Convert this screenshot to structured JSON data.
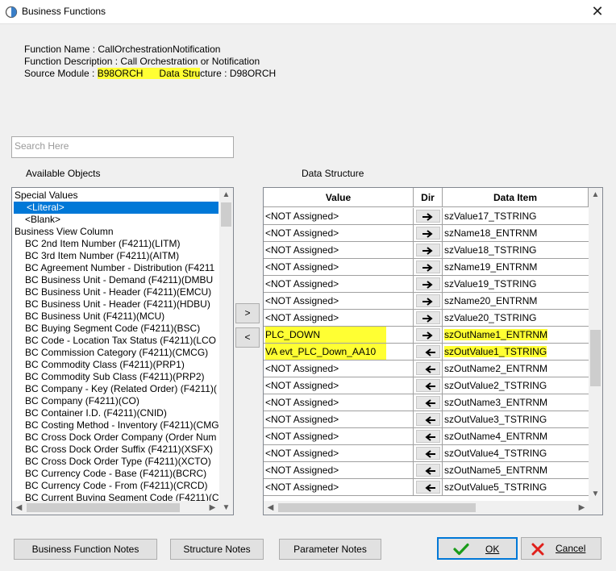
{
  "window": {
    "title": "Business Functions",
    "close_symbol": "✕"
  },
  "info": {
    "function_name_label": "Function Name : ",
    "function_name": "CallOrchestrationNotification",
    "function_description_label": "Function Description : ",
    "function_description": "Call Orchestration or Notification",
    "source_module_label": "Source Module : ",
    "source_module": "B98ORCH",
    "data_structure_label": "Data Structure : ",
    "data_structure": "D98ORCH",
    "data_structure_label_prefix": "Data Stru",
    "data_structure_label_suffix": "cture : "
  },
  "search": {
    "placeholder": "Search Here"
  },
  "available_objects": {
    "label": "Available Objects",
    "items": [
      "Special Values",
      "<Literal>",
      "<Blank>",
      "Business View Column",
      "BC 2nd Item Number (F4211)(LITM)",
      "BC 3rd Item Number (F4211)(AITM)",
      "BC Agreement Number - Distribution (F4211",
      "BC Business Unit - Demand (F4211)(DMBU",
      "BC Business Unit - Header (F4211)(EMCU)",
      "BC Business Unit - Header (F4211)(HDBU)",
      "BC Business Unit (F4211)(MCU)",
      "BC Buying Segment Code (F4211)(BSC)",
      "BC Code - Location Tax Status (F4211)(LCO",
      "BC Commission Category (F4211)(CMCG)",
      "BC Commodity Class (F4211)(PRP1)",
      "BC Commodity Sub Class (F4211)(PRP2)",
      "BC Company - Key (Related Order) (F4211)(",
      "BC Company (F4211)(CO)",
      "BC Container I.D. (F4211)(CNID)",
      "BC Costing Method - Inventory (F4211)(CMG",
      "BC Cross Dock Order Company (Order Num",
      "BC Cross Dock Order Suffix (F4211)(XSFX)",
      "BC Cross Dock Order Type (F4211)(XCTO)",
      "BC Currency Code - Base (F4211)(BCRC)",
      "BC Currency Code - From (F4211)(CRCD)",
      "BC Current Buying Segment Code (F4211)(C"
    ],
    "selected_index": 1
  },
  "move_buttons": {
    "add": ">",
    "remove": "<"
  },
  "data_structure": {
    "label": "Data Structure",
    "columns": {
      "value": "Value",
      "dir": "Dir",
      "item": "Data Item"
    },
    "rows": [
      {
        "value": "<NOT Assigned>",
        "dir": "right",
        "item": "szValue17_TSTRING",
        "highlight": false
      },
      {
        "value": "<NOT Assigned>",
        "dir": "right",
        "item": "szName18_ENTRNM",
        "highlight": false
      },
      {
        "value": "<NOT Assigned>",
        "dir": "right",
        "item": "szValue18_TSTRING",
        "highlight": false
      },
      {
        "value": "<NOT Assigned>",
        "dir": "right",
        "item": "szName19_ENTRNM",
        "highlight": false
      },
      {
        "value": "<NOT Assigned>",
        "dir": "right",
        "item": "szValue19_TSTRING",
        "highlight": false
      },
      {
        "value": "<NOT Assigned>",
        "dir": "right",
        "item": "szName20_ENTRNM",
        "highlight": false
      },
      {
        "value": "<NOT Assigned>",
        "dir": "right",
        "item": "szValue20_TSTRING",
        "highlight": false
      },
      {
        "value": "PLC_DOWN",
        "dir": "right",
        "item": "szOutName1_ENTRNM",
        "highlight": true
      },
      {
        "value": "VA evt_PLC_Down_AA10",
        "dir": "left",
        "item": "szOutValue1_TSTRING",
        "highlight": true
      },
      {
        "value": "<NOT Assigned>",
        "dir": "left",
        "item": "szOutName2_ENTRNM",
        "highlight": false
      },
      {
        "value": "<NOT Assigned>",
        "dir": "left",
        "item": "szOutValue2_TSTRING",
        "highlight": false
      },
      {
        "value": "<NOT Assigned>",
        "dir": "left",
        "item": "szOutName3_ENTRNM",
        "highlight": false
      },
      {
        "value": "<NOT Assigned>",
        "dir": "left",
        "item": "szOutValue3_TSTRING",
        "highlight": false
      },
      {
        "value": "<NOT Assigned>",
        "dir": "left",
        "item": "szOutName4_ENTRNM",
        "highlight": false
      },
      {
        "value": "<NOT Assigned>",
        "dir": "left",
        "item": "szOutValue4_TSTRING",
        "highlight": false
      },
      {
        "value": "<NOT Assigned>",
        "dir": "left",
        "item": "szOutName5_ENTRNM",
        "highlight": false
      },
      {
        "value": "<NOT Assigned>",
        "dir": "left",
        "item": "szOutValue5_TSTRING",
        "highlight": false
      }
    ]
  },
  "footer": {
    "bf_notes": "Business Function Notes",
    "structure_notes": "Structure Notes",
    "parameter_notes": "Parameter Notes",
    "ok": "OK",
    "cancel": "Cancel"
  },
  "colors": {
    "highlight": "#ffff33",
    "selection": "#0078d7",
    "ok_check": "#1a9c1a",
    "cancel_x": "#e0201b"
  }
}
